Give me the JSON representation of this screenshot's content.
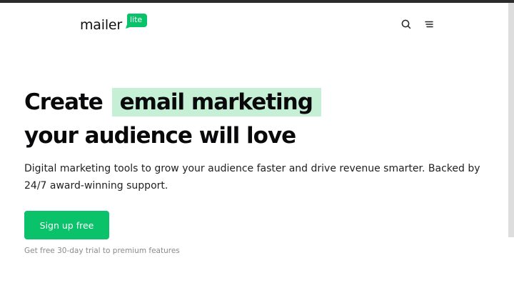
{
  "header": {
    "logo_text": "mailer",
    "logo_badge": "lite",
    "search_icon": "search-icon",
    "menu_icon": "menu-icon"
  },
  "hero": {
    "headline_prefix": "Create",
    "headline_highlight": "email marketing",
    "headline_line2": "your audience will love",
    "lead": "Digital marketing tools to grow your audience faster and drive revenue smarter. Backed by 24/7 award-winning support.",
    "cta_label": "Sign up free",
    "trial_note": "Get free 30-day trial to premium features"
  },
  "colors": {
    "brand_green": "#09c269",
    "highlight_bg": "#c6f0d6",
    "text_dark": "#09090b"
  }
}
